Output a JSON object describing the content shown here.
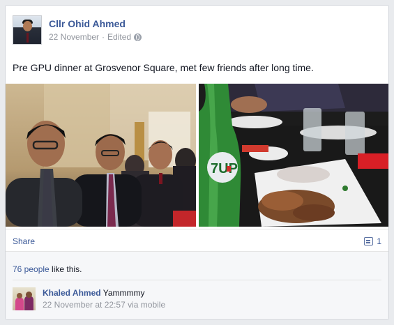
{
  "post": {
    "author": "Cllr Ohid Ahmed",
    "date": "22 November",
    "separator": "·",
    "edited": "Edited",
    "text": "Pre GPU dinner at Grosvenor Square, met few friends after long time."
  },
  "actions": {
    "share_label": "Share",
    "comment_count": "1"
  },
  "likes": {
    "count_text": "76 people",
    "suffix": " like this."
  },
  "comments": [
    {
      "author": "Khaled Ahmed",
      "text": "Yammmmy",
      "time": "22 November at 22:57",
      "via": "via mobile"
    }
  ],
  "photos": [
    {
      "name": "group-selfie-photo",
      "bottle_text": ""
    },
    {
      "name": "dinner-table-photo",
      "bottle_text": "7UP"
    }
  ],
  "colors": {
    "link": "#3b5998",
    "muted": "#90949c",
    "background": "#e9ebee"
  }
}
